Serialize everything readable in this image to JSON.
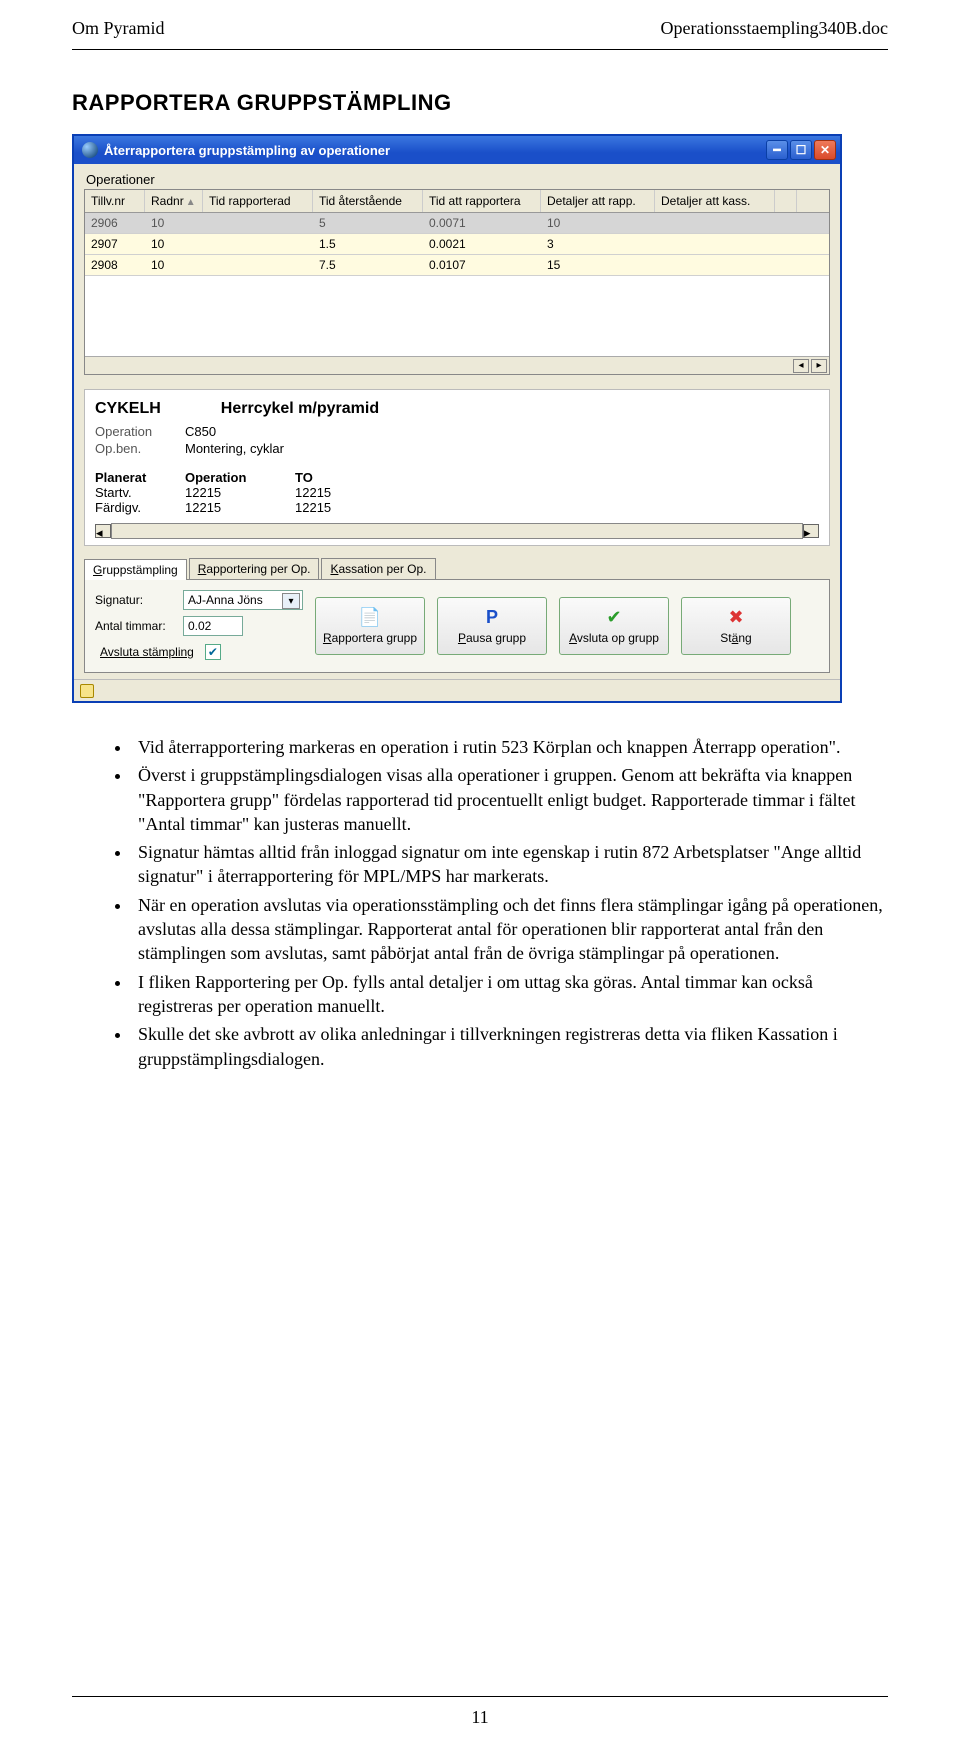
{
  "header": {
    "left": "Om Pyramid",
    "right": "Operationsstaempling340B.doc"
  },
  "section_heading": "RAPPORTERA GRUPPSTÄMPLING",
  "dialog": {
    "title": "Återrapportera gruppstämpling av operationer",
    "fieldset_label": "Operationer",
    "columns": [
      "Tillv.nr",
      "Radnr",
      "Tid rapporterad",
      "Tid återstående",
      "Tid att rapportera",
      "Detaljer att rapp.",
      "Detaljer att kass."
    ],
    "rows": [
      {
        "c": [
          "2906",
          "10",
          "",
          "5",
          "0.0071",
          "10",
          ""
        ]
      },
      {
        "c": [
          "2907",
          "10",
          "",
          "1.5",
          "0.0021",
          "3",
          ""
        ]
      },
      {
        "c": [
          "2908",
          "10",
          "",
          "7.5",
          "0.0107",
          "15",
          ""
        ]
      }
    ],
    "detail": {
      "code": "CYKELH",
      "name": "Herrcykel m/pyramid",
      "operation_label": "Operation",
      "operation_value": "C850",
      "opben_label": "Op.ben.",
      "opben_value": "Montering, cyklar",
      "col_planned": "Planerat",
      "col_operation": "Operation",
      "col_to": "TO",
      "startv_label": "Startv.",
      "startv_op": "12215",
      "startv_to": "12215",
      "fardigv_label": "Färdigv.",
      "fardigv_op": "12215",
      "fardigv_to": "12215"
    },
    "tabs": {
      "t1": "Gruppstämpling",
      "t2": "Rapportering per Op.",
      "t3": "Kassation per Op."
    },
    "panel": {
      "signatur_label": "Signatur:",
      "signatur_value": "AJ-Anna Jöns",
      "antal_label": "Antal timmar:",
      "antal_value": "0.02",
      "avsluta_link": "Avsluta stämpling",
      "btn_rapportera": "Rapportera grupp",
      "btn_pausa": "Pausa grupp",
      "btn_avsluta": "Avsluta op grupp",
      "btn_stang": "Stäng"
    }
  },
  "bullets": [
    "Vid återrapportering markeras en operation i rutin 523 Körplan och knappen Återrapp operation\".",
    "Överst i gruppstämplingsdialogen visas alla operationer i gruppen. Genom att bekräfta via knappen \"Rapportera grupp\" fördelas rapporterad tid procentuellt enligt budget. Rapporterade timmar i fältet \"Antal timmar\" kan justeras manuellt.",
    "Signatur hämtas alltid från inloggad signatur om inte egenskap i rutin 872 Arbetsplatser \"Ange alltid signatur\" i återrapportering för MPL/MPS har markerats.",
    "När en operation avslutas via operationsstämpling och det finns flera stämplingar igång på operationen, avslutas alla dessa stämplingar. Rapporterat antal för operationen blir rapporterat antal från den stämplingen som avslutas, samt påbörjat antal från de övriga stämplingar på operationen.",
    "I fliken Rapportering per Op. fylls antal detaljer i om uttag ska göras. Antal timmar kan också registreras per operation manuellt.",
    "Skulle det ske avbrott av olika anledningar i tillverkningen registreras detta via fliken Kassation i gruppstämplingsdialogen."
  ],
  "page_number": "11"
}
